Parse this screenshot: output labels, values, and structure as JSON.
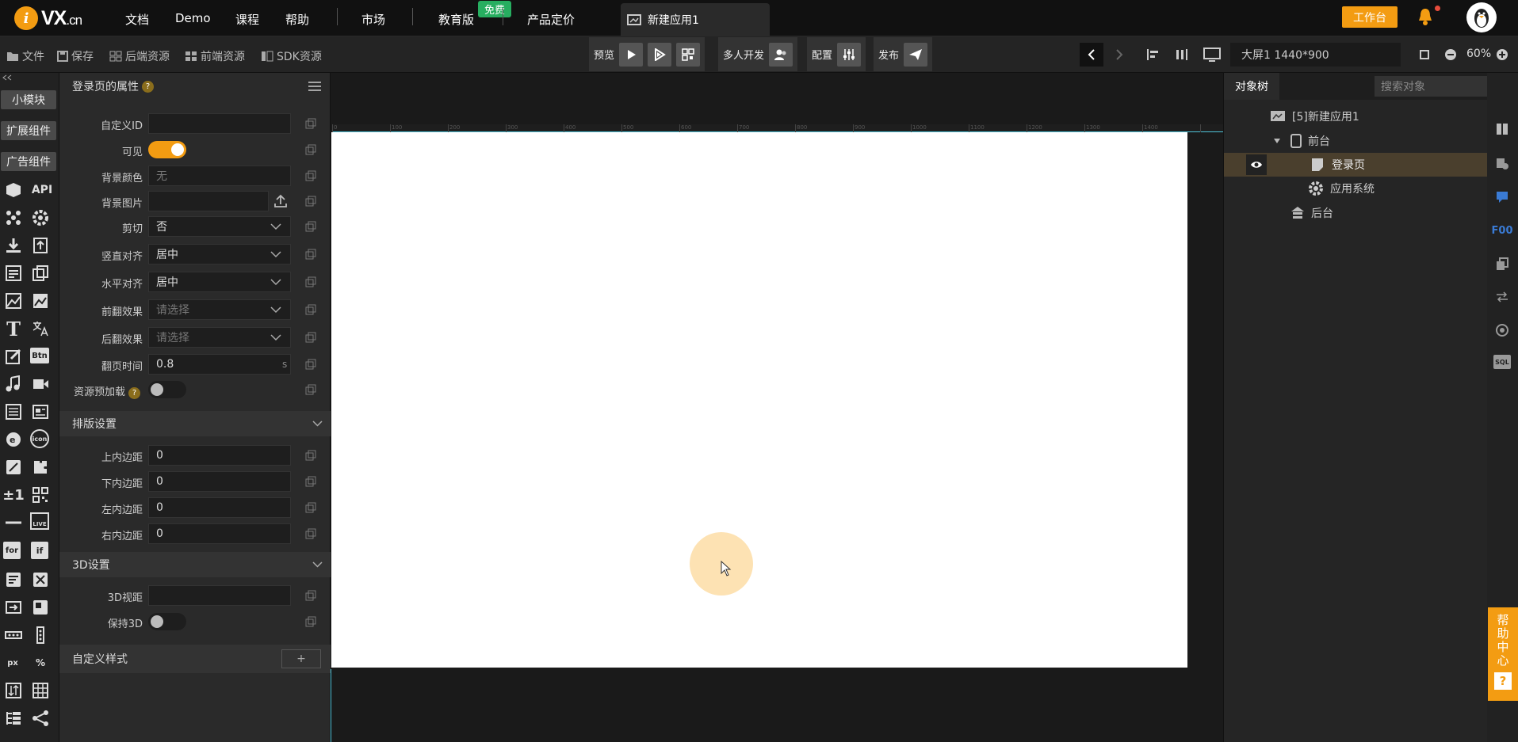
{
  "topbar": {
    "logo_mark": "i",
    "logo_text": "VX",
    "logo_suffix": ".cn",
    "nav": [
      "文档",
      "Demo",
      "课程",
      "帮助"
    ],
    "market": "市场",
    "education": "教育版",
    "free_badge": "免费",
    "pricing": "产品定价",
    "app_tab": "新建应用1",
    "workbench": "工作台"
  },
  "toolbar": {
    "file": "文件",
    "save": "保存",
    "backend_res": "后端资源",
    "frontend_res": "前端资源",
    "sdk_res": "SDK资源",
    "preview": "预览",
    "multi_dev": "多人开发",
    "config": "配置",
    "publish": "发布",
    "screen": "大屏1 1440*900",
    "zoom": "60%"
  },
  "leftcol": {
    "small_module": "小模块",
    "ext_components": "扩展组件",
    "ad_components": "广告组件",
    "api": "API",
    "btn": "Btn",
    "icon": "icon",
    "for": "for",
    "if": "if",
    "px": "px",
    "pct": "%",
    "live": "LIVE",
    "plusminus": "±1"
  },
  "props": {
    "title": "登录页的属性",
    "custom_id": "自定义ID",
    "visible": "可见",
    "bg_color": "背景颜色",
    "bg_color_value": "无",
    "bg_image": "背景图片",
    "clip": "剪切",
    "clip_value": "否",
    "valign": "竖直对齐",
    "valign_value": "居中",
    "halign": "水平对齐",
    "halign_value": "居中",
    "front_flip": "前翻效果",
    "back_flip": "后翻效果",
    "select_placeholder": "请选择",
    "flip_time": "翻页时间",
    "flip_time_value": "0.8",
    "flip_time_unit": "s",
    "preload": "资源预加载",
    "layout_section": "排版设置",
    "pad_top": "上内边距",
    "pad_bottom": "下内边距",
    "pad_left": "左内边距",
    "pad_right": "右内边距",
    "pad_value": "0",
    "section_3d": "3D设置",
    "view_3d": "3D视距",
    "keep_3d": "保持3D",
    "custom_style": "自定义样式",
    "add": "+"
  },
  "ruler": [
    "0",
    "100",
    "200",
    "300",
    "400",
    "500",
    "600",
    "700",
    "800",
    "900",
    "1000",
    "1100",
    "1200",
    "1300",
    "1400"
  ],
  "rightpanel": {
    "tab": "对象树",
    "search_placeholder": "搜索对象",
    "tree": [
      {
        "label": "[5]新建应用1"
      },
      {
        "label": "前台"
      },
      {
        "label": "登录页"
      },
      {
        "label": "应用系统"
      },
      {
        "label": "后台"
      }
    ]
  },
  "rightrail": {
    "foo": "F00",
    "sql": "SQL"
  },
  "help": {
    "line1": "帮",
    "line2": "助",
    "line3": "中",
    "line4": "心",
    "q": "?"
  }
}
